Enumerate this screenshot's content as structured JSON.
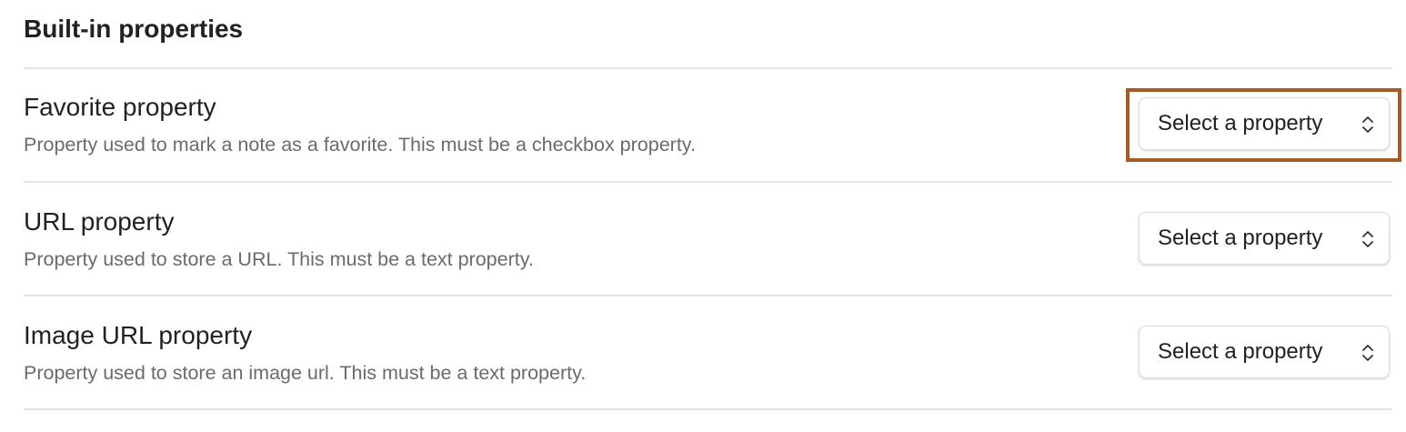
{
  "section": {
    "title": "Built-in properties"
  },
  "rows": [
    {
      "name": "Favorite property",
      "description": "Property used to mark a note as a favorite. This must be a checkbox property.",
      "select_value": "Select a property"
    },
    {
      "name": "URL property",
      "description": "Property used to store a URL. This must be a text property.",
      "select_value": "Select a property"
    },
    {
      "name": "Image URL property",
      "description": "Property used to store an image url. This must be a text property.",
      "select_value": "Select a property"
    }
  ],
  "highlight": {
    "target": "favorite-property-select",
    "color": "#a55a2a"
  },
  "icons": {
    "select": "chevron-up-down-icon"
  }
}
